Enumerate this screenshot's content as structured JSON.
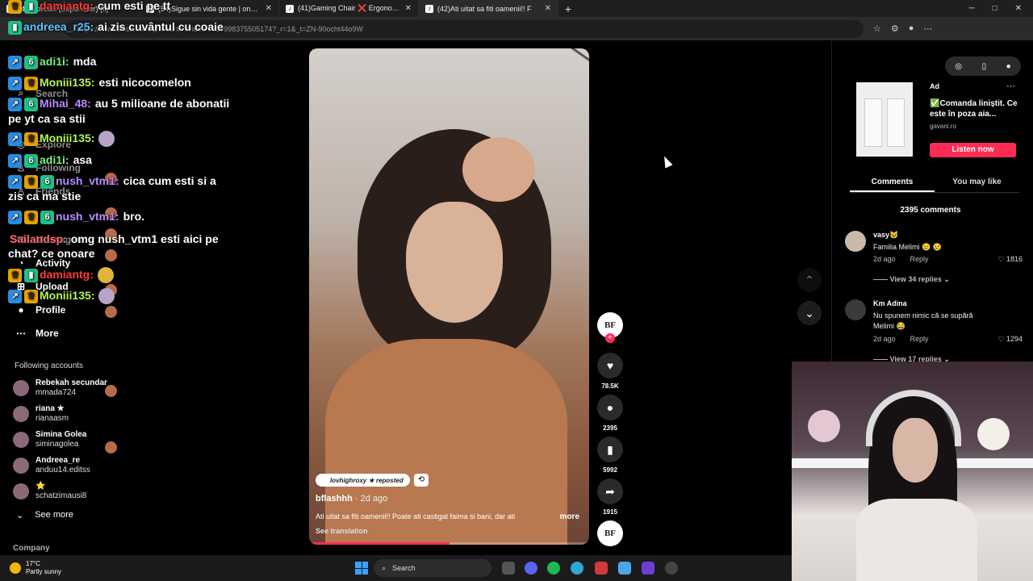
{
  "browser": {
    "tabs": [
      {
        "title": "(41)Aplicatii  (Supervisor) (fl)"
      },
      {
        "title": "(54)Sigue sin vida gente | one piec"
      },
      {
        "title": "(41)Gaming Chair ❌ Ergonomic"
      },
      {
        "title": "(42)Ati uitat sa fiti oamenii!! F"
      }
    ],
    "new_tab": "+",
    "url": "https://www.tiktok.com/@bflashhh/video/7329998375505174?_r=1&_t=ZN-90ocht44o9W"
  },
  "sidebar": {
    "items": [
      {
        "icon": "search-icon",
        "label": "Search"
      },
      {
        "icon": "explore-icon",
        "label": "Explore"
      },
      {
        "icon": "following-icon",
        "label": "Following"
      },
      {
        "icon": "friends-icon",
        "label": "Friends"
      },
      {
        "icon": "messages-icon",
        "label": "Messages"
      },
      {
        "icon": "activity-icon",
        "label": "Activity"
      },
      {
        "icon": "upload-icon",
        "label": "Upload"
      },
      {
        "icon": "profile-icon",
        "label": "Profile"
      },
      {
        "icon": "more-icon",
        "label": "More"
      }
    ],
    "following_title": "Following accounts",
    "accounts": [
      {
        "name": "Rebekah secundar",
        "handle": "mmada724"
      },
      {
        "name": "riana ★",
        "handle": "rianaasm"
      },
      {
        "name": "Simina Golea",
        "handle": "siminagolea"
      },
      {
        "name": "Andreea_re",
        "handle": "anduu14.editss"
      },
      {
        "name": "⭐",
        "handle": "schatzimausi8"
      }
    ],
    "see_more": "See more",
    "company": "Company"
  },
  "chat": [
    {
      "user": "damiantg:",
      "text": "cum esti pe tt",
      "color": "#ff3b3b"
    },
    {
      "user": "andreea_r25:",
      "text": "ai zis cuvântul cu coaie",
      "color": "#5ec6ff"
    },
    {
      "user": "adi1i:",
      "text": "mda",
      "color": "#7cf07c"
    },
    {
      "user": "Moniii135:",
      "text": "esti nicocomelon",
      "color": "#b6f35a"
    },
    {
      "user": "Mihai_48:",
      "text": "au 5 milioane de abonatii pe yt ca sa stii",
      "color": "#b78bff"
    },
    {
      "user": "Moniii135:",
      "text": "",
      "color": "#b6f35a"
    },
    {
      "user": "adi1i:",
      "text": "asa",
      "color": "#7cf07c"
    },
    {
      "user": "nush_vtm1:",
      "text": "cica cum esti si a zis ca ma stie",
      "color": "#b78bff"
    },
    {
      "user": "nush_vtm1:",
      "text": "bro.",
      "color": "#b78bff"
    },
    {
      "user": "Sailandsp:",
      "text": "omg nush_vtm1 esti aici pe chat? ce onoare",
      "color": "#ff6b6b"
    },
    {
      "user": "damiantg:",
      "text": "",
      "color": "#ff3b3b"
    },
    {
      "user": "Moniii135:",
      "text": "",
      "color": "#b6f35a"
    }
  ],
  "video": {
    "repost_label": "lovhighroxy ★ reposted",
    "author": "bflashhh",
    "date": "· 2d ago",
    "caption": "Ati uitat sa fiti oamenii!! Poate ati castigat faima si bani, dar ati",
    "more": "more",
    "see_translation": "See translation",
    "progress": 0.5
  },
  "actions": {
    "creator_initials": "BF",
    "likes": "78.5K",
    "comments": "2395",
    "saves": "5992",
    "shares": "1915"
  },
  "right_panel": {
    "ad_label": "Ad",
    "ad_text": "✅Comanda liniștit. Ce este în poza aia...",
    "ad_domain": "gavani.ro",
    "ad_button": "Listen now",
    "tabs": [
      "Comments",
      "You may like"
    ],
    "comment_count": "2395 comments",
    "comments": [
      {
        "user": "vasy🐱",
        "text": "Familia Melimi 😢 😢",
        "date": "2d ago",
        "reply": "Reply",
        "likes": "1816",
        "replies": "View 34 replies"
      },
      {
        "user": "Km Adina",
        "text": "Nu spunem nimic că se supără Melimi 😂",
        "date": "2d ago",
        "reply": "Reply",
        "likes": "1294",
        "replies": "View 17 replies"
      }
    ]
  },
  "taskbar": {
    "temp": "17°C",
    "weather": "Partly sunny",
    "search": "Search"
  },
  "colors": {
    "accent": "#fe2c55",
    "background": "#000000"
  }
}
